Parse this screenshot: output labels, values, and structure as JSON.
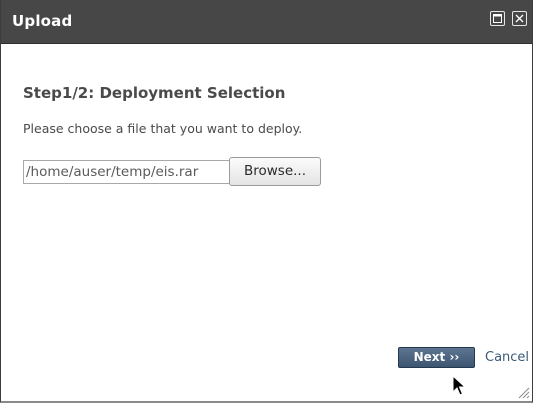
{
  "window": {
    "title": "Upload"
  },
  "titlebar": {
    "maximize_icon": "maximize-icon",
    "close_icon": "close-icon"
  },
  "content": {
    "step_title": "Step1/2: Deployment Selection",
    "instructions": "Please choose a file that you want to deploy.",
    "file_path_value": "/home/auser/temp/eis.rar",
    "browse_label": "Browse..."
  },
  "footer": {
    "next_label": "Next ››",
    "cancel_label": "Cancel"
  },
  "colors": {
    "titlebar_bg": "#474747",
    "next_button_bg": "#4a6380",
    "link_color": "#3c5a78"
  }
}
